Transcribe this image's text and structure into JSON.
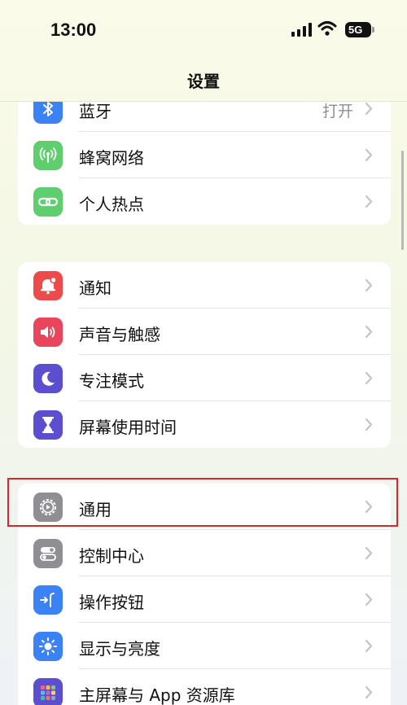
{
  "status_bar": {
    "time": "13:00",
    "battery_label": "5G"
  },
  "nav": {
    "title": "设置"
  },
  "groups": [
    {
      "items": [
        {
          "label": "蓝牙",
          "value": "打开",
          "icon": "bluetooth-icon",
          "color": "#3a82f6"
        },
        {
          "label": "蜂窝网络",
          "icon": "cellular-antenna-icon",
          "color": "#5fce6f"
        },
        {
          "label": "个人热点",
          "icon": "hotspot-link-icon",
          "color": "#5fce6f"
        }
      ]
    },
    {
      "items": [
        {
          "label": "通知",
          "icon": "notification-bell-icon",
          "color": "#ec4b4b"
        },
        {
          "label": "声音与触感",
          "icon": "speaker-icon",
          "color": "#e9455c"
        },
        {
          "label": "专注模式",
          "icon": "moon-icon",
          "color": "#5b4fcf"
        },
        {
          "label": "屏幕使用时间",
          "icon": "hourglass-icon",
          "color": "#5b4fcf"
        }
      ]
    },
    {
      "items": [
        {
          "label": "通用",
          "icon": "gear-icon",
          "color": "#8e8e93"
        },
        {
          "label": "控制中心",
          "icon": "toggles-icon",
          "color": "#8e8e93"
        },
        {
          "label": "操作按钮",
          "icon": "action-button-icon",
          "color": "#3a82f6"
        },
        {
          "label": "显示与亮度",
          "icon": "sun-icon",
          "color": "#3a82f6"
        },
        {
          "label": "主屏幕与 App 资源库",
          "icon": "app-grid-icon",
          "color": "#5b4fcf"
        }
      ]
    }
  ]
}
